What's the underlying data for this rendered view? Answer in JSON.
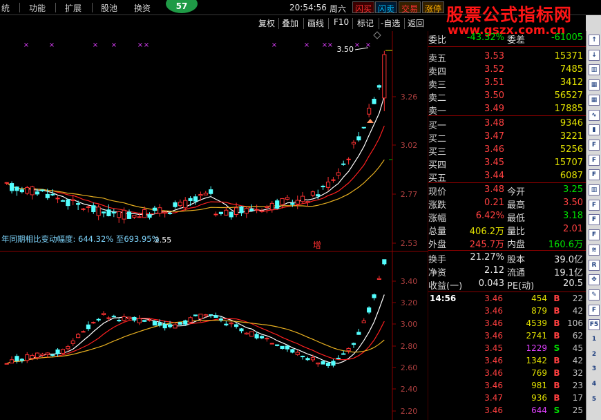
{
  "menu": {
    "items": [
      "统",
      "功能",
      "扩展",
      "股池",
      "换资"
    ],
    "badge": "57",
    "clock": "20:54:56",
    "weekday": "周六",
    "buttons": [
      {
        "label": "闪买",
        "color": "#ff3030"
      },
      {
        "label": "闪卖",
        "color": "#00c0ff"
      },
      {
        "label": "交易",
        "color": "#ff3030"
      },
      {
        "label": "涨停",
        "color": "#ffb000"
      }
    ]
  },
  "watermark": {
    "line1": "股票公式指标网",
    "line2": "www.gszx.com.cn"
  },
  "toolbar": [
    "复权",
    "叠加",
    "画线",
    "F10",
    "标记",
    "-自选",
    "返回"
  ],
  "chart_data": [
    {
      "type": "candlestick",
      "panel": "main",
      "y_ticks": [
        "3.26",
        "3.02",
        "2.77",
        "2.53"
      ],
      "annotation_high": "3.50",
      "annotation_low": "2.55",
      "formula_text": "年同期相比变动幅度: 644.32% 至693.95%",
      "marker_text": "增",
      "ylim": [
        2.45,
        3.55
      ]
    },
    {
      "type": "candlestick",
      "panel": "indicator",
      "y_ticks": [
        "3.40",
        "3.20",
        "3.00",
        "2.80",
        "2.60",
        "2.40",
        "2.20"
      ],
      "ylim": [
        2.17,
        3.55
      ]
    }
  ],
  "quote": {
    "weibi_label": "委比",
    "weibi_value": "-43.32%",
    "weicha_label": "委差",
    "weicha_value": "-61005",
    "sell": [
      {
        "label": "卖五",
        "price": "3.53",
        "vol": "15371"
      },
      {
        "label": "卖四",
        "price": "3.52",
        "vol": "7485"
      },
      {
        "label": "卖三",
        "price": "3.51",
        "vol": "3412"
      },
      {
        "label": "卖二",
        "price": "3.50",
        "vol": "56527"
      },
      {
        "label": "卖一",
        "price": "3.49",
        "vol": "17885"
      }
    ],
    "buy": [
      {
        "label": "买一",
        "price": "3.48",
        "vol": "9346"
      },
      {
        "label": "买二",
        "price": "3.47",
        "vol": "3221"
      },
      {
        "label": "买三",
        "price": "3.46",
        "vol": "5256"
      },
      {
        "label": "买四",
        "price": "3.45",
        "vol": "15707"
      },
      {
        "label": "买五",
        "price": "3.44",
        "vol": "6087"
      }
    ],
    "stats": [
      {
        "l1": "现价",
        "v1": "3.48",
        "c1": "#ff4040",
        "l2": "今开",
        "v2": "3.25",
        "c2": "#00e000"
      },
      {
        "l1": "涨跌",
        "v1": "0.21",
        "c1": "#ff4040",
        "l2": "最高",
        "v2": "3.50",
        "c2": "#ff4040"
      },
      {
        "l1": "涨幅",
        "v1": "6.42%",
        "c1": "#ff4040",
        "l2": "最低",
        "v2": "3.18",
        "c2": "#00e000"
      },
      {
        "l1": "总量",
        "v1": "406.2万",
        "c1": "#e0e000",
        "l2": "量比",
        "v2": "2.01",
        "c2": "#ff4040"
      },
      {
        "l1": "外盘",
        "v1": "245.7万",
        "c1": "#ff4040",
        "l2": "内盘",
        "v2": "160.6万",
        "c2": "#00e000"
      }
    ],
    "fundamentals": [
      {
        "l1": "换手",
        "v1": "21.27%",
        "l2": "股本",
        "v2": "39.0亿"
      },
      {
        "l1": "净资",
        "v1": "2.12",
        "l2": "流通",
        "v2": "19.1亿"
      },
      {
        "l1": "收益(一)",
        "v1": "0.043",
        "l2": "PE(动)",
        "v2": "20.5"
      }
    ]
  },
  "ticks": {
    "time": "14:56",
    "rows": [
      {
        "price": "3.46",
        "vol": "454",
        "bs": "B",
        "cnt": "22"
      },
      {
        "price": "3.46",
        "vol": "879",
        "bs": "B",
        "cnt": "42"
      },
      {
        "price": "3.46",
        "vol": "4539",
        "bs": "B",
        "cnt": "106"
      },
      {
        "price": "3.46",
        "vol": "2741",
        "bs": "B",
        "cnt": "62"
      },
      {
        "price": "3.45",
        "vol": "1229",
        "bs": "S",
        "cnt": "45"
      },
      {
        "price": "3.46",
        "vol": "1342",
        "bs": "B",
        "cnt": "42"
      },
      {
        "price": "3.46",
        "vol": "769",
        "bs": "B",
        "cnt": "32"
      },
      {
        "price": "3.46",
        "vol": "981",
        "bs": "B",
        "cnt": "23"
      },
      {
        "price": "3.47",
        "vol": "936",
        "bs": "B",
        "cnt": "17"
      },
      {
        "price": "3.46",
        "vol": "644",
        "bs": "S",
        "cnt": "25"
      }
    ]
  },
  "sidebar": [
    "arrow-up-icon",
    "arrow-down-icon",
    "chart-icon",
    "table-icon",
    "table-icon",
    "line-icon",
    "bar-icon",
    "f10-icon",
    "f10-icon",
    "f10-icon",
    "chart-icon",
    "f12-icon",
    "f10-icon",
    "f10-icon",
    "grid-icon",
    "rsi-icon",
    "move-icon",
    "edit-icon",
    "f10-icon",
    "f5-icon",
    "1",
    "2",
    "3",
    "4",
    "5"
  ]
}
